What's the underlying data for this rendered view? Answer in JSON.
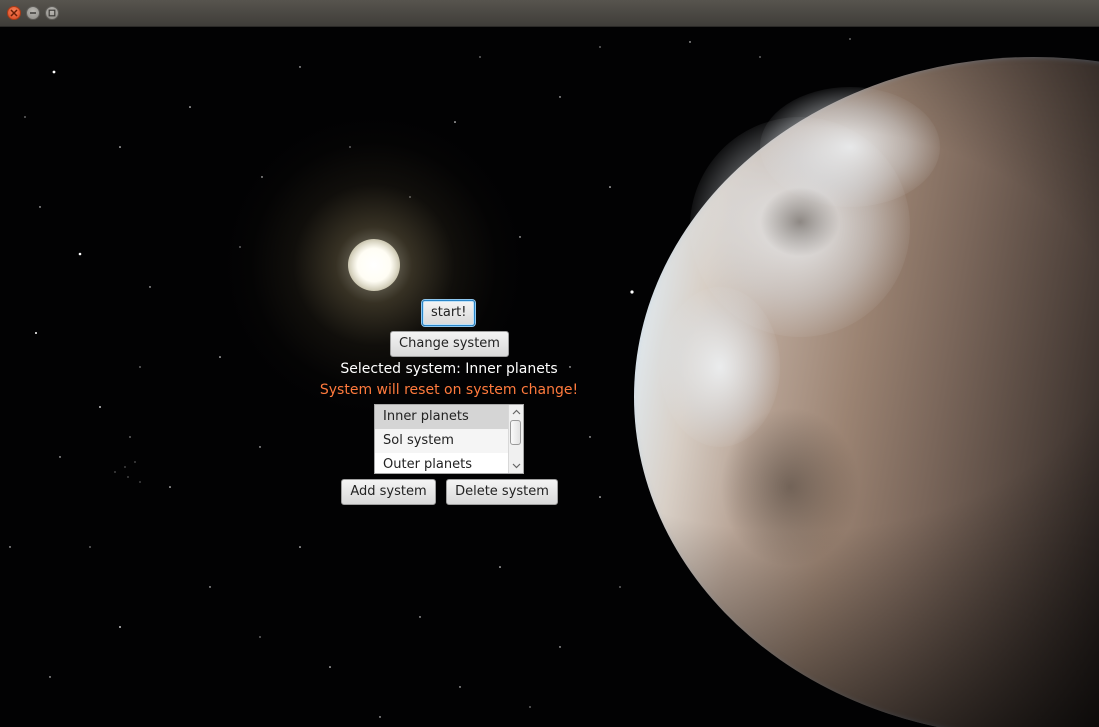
{
  "window": {
    "buttons": [
      "close-icon",
      "minimize-icon",
      "maximize-icon"
    ]
  },
  "controls": {
    "start_label": "start!",
    "change_system_label": "Change system",
    "selected_system_text": "Selected system: Inner planets",
    "warning_text": "System will reset on system change!",
    "warning_color": "#ff7a3d",
    "add_system_label": "Add system",
    "delete_system_label": "Delete system"
  },
  "system_list": {
    "items": [
      "Inner planets",
      "Sol system",
      "Outer planets"
    ],
    "selected_index": 0
  }
}
